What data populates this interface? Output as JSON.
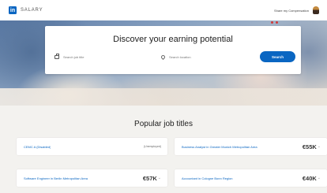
{
  "header": {
    "brand_letter": "in",
    "brand_name": "SALARY",
    "right_link": "Share my Compensation"
  },
  "hero": {
    "title": "Discover your earning potential",
    "job_placeholder": "Search job title",
    "location_placeholder": "Search location",
    "search_label": "Search"
  },
  "popular": {
    "title": "Popular job titles",
    "jobs": [
      {
        "title": "CEMC A (Disabled)",
        "value": "(Unemployed)"
      },
      {
        "title": "Business Analyst in Greater Munich Metropolitan Area",
        "value": "€55K"
      },
      {
        "title": "Software Engineer in Berlin Metropolitan Area",
        "value": "€57K"
      },
      {
        "title": "Accountant in Cologne Bonn Region",
        "value": "€40K"
      }
    ]
  },
  "colors": {
    "brand_blue": "#0a66c2",
    "background": "#f3f2ef"
  },
  "icons": {
    "job_field": "briefcase-icon",
    "location_field": "location-pin-icon"
  }
}
